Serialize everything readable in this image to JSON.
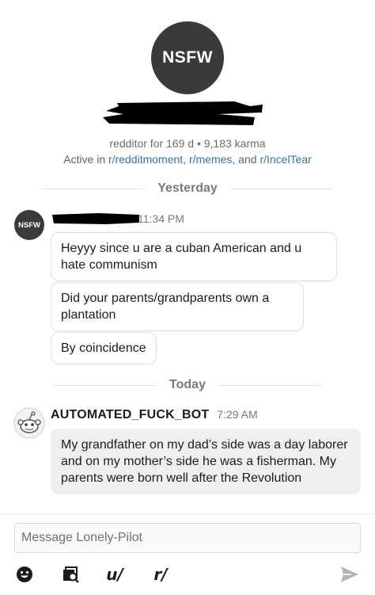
{
  "profile": {
    "avatar_text": "NSFW",
    "meta": "redditor for 169 d • 9,183 karma",
    "active_prefix": "Active in ",
    "active_sub1": "r/redditmoment",
    "active_sep1": ", ",
    "active_sub2": "r/memes",
    "active_sep2": ", and ",
    "active_sub3": "r/IncelTear"
  },
  "dividers": {
    "yesterday": "Yesterday",
    "today": "Today"
  },
  "thread1": {
    "avatar_text": "NSFW",
    "time": "11:34 PM",
    "messages": [
      "Heyyy since u are a cuban American and u hate communism",
      "Did your parents/grandparents own a plantation",
      "By coincidence"
    ]
  },
  "thread2": {
    "author": "AUTOMATED_FUCK_BOT",
    "time": "7:29 AM",
    "message": "My grandfather on my dad’s side was a day laborer and on my mother’s side he was a fisherman. My parents were born well after the Revolution"
  },
  "composer": {
    "placeholder": "Message Lonely-Pilot",
    "user_link": "u/",
    "sub_link": "r/"
  },
  "icons": {
    "emoji": "emoji-icon",
    "image": "image-search-icon",
    "send": "send-icon"
  }
}
